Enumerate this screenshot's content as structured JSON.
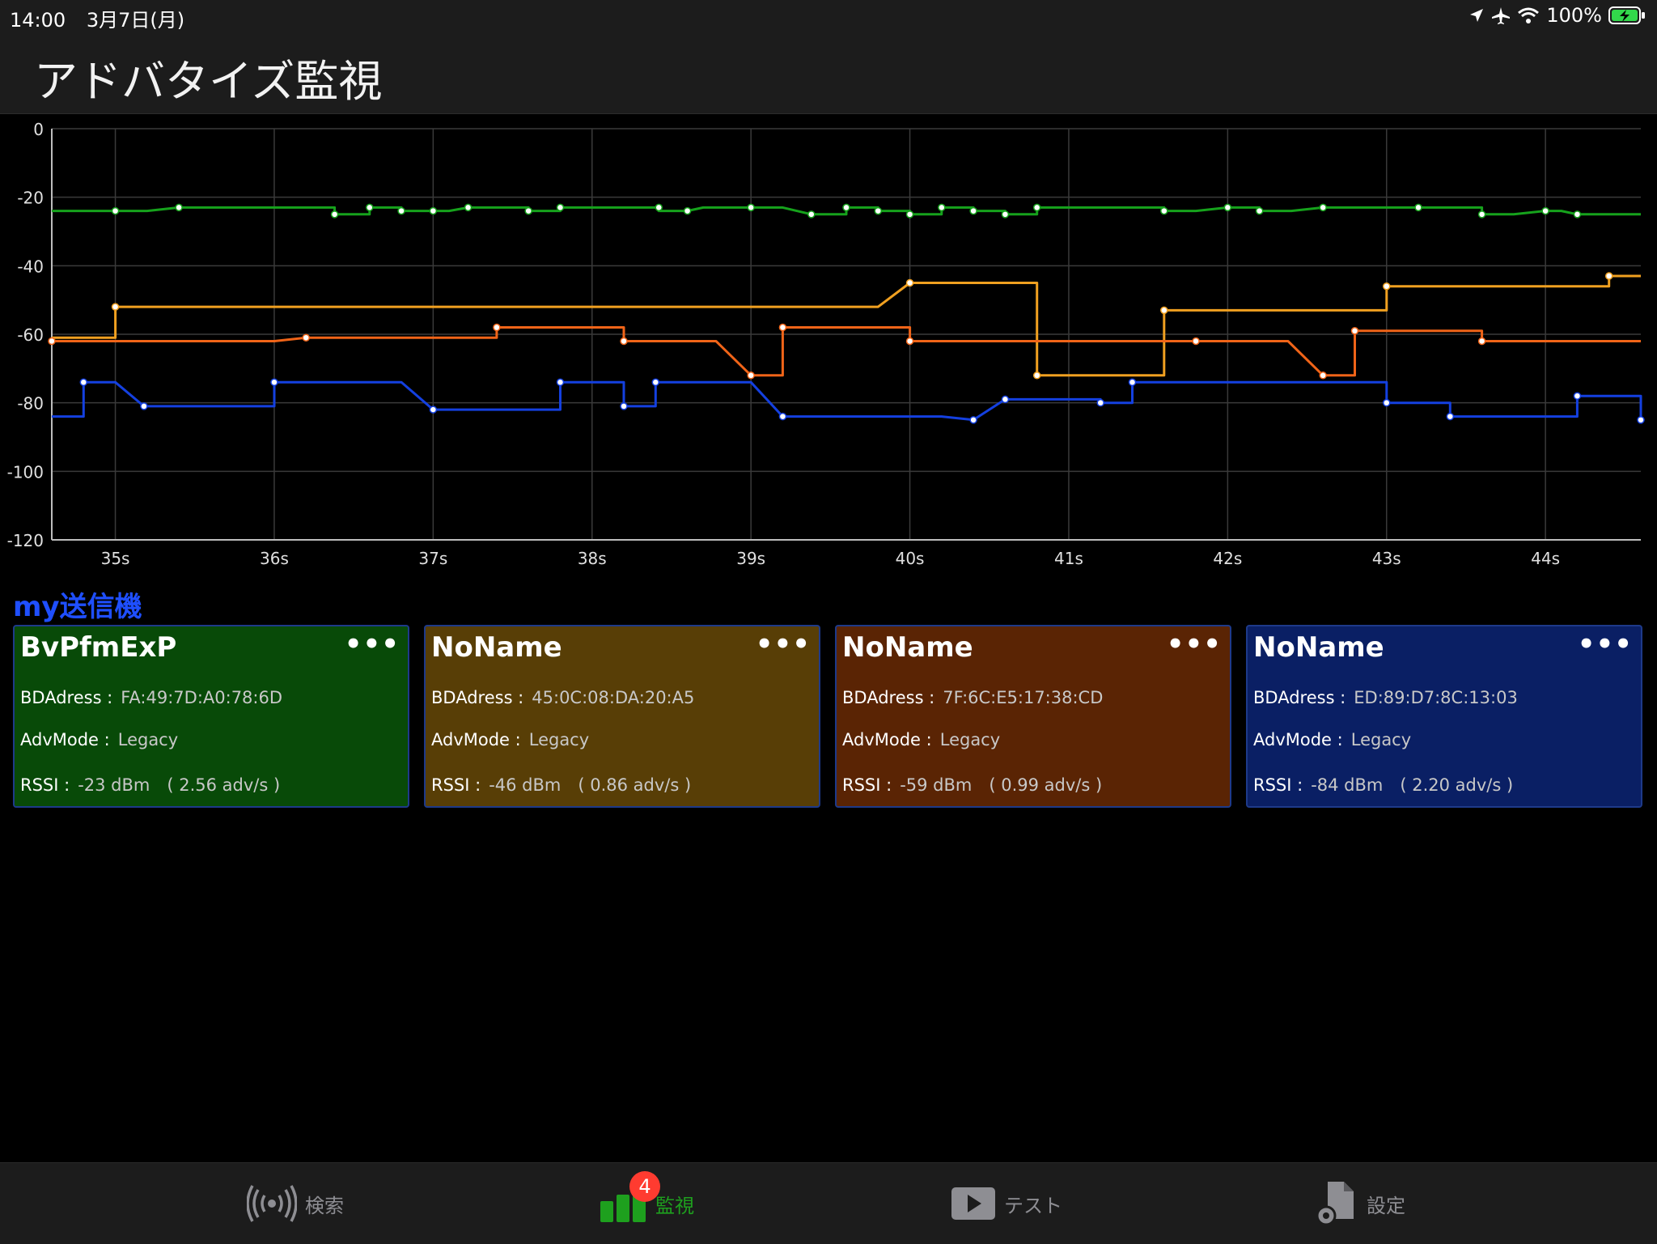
{
  "status": {
    "time": "14:00",
    "date": "3月7日(月)",
    "battery": "100%"
  },
  "nav": {
    "title": "アドバタイズ監視"
  },
  "chart_data": {
    "type": "line",
    "xlim": [
      34.6,
      44.6
    ],
    "ylim": [
      -120,
      0
    ],
    "yticks": [
      "0",
      "-20",
      "-40",
      "-60",
      "-80",
      "-100",
      "-120"
    ],
    "yvals": [
      0,
      -20,
      -40,
      -60,
      -80,
      -100,
      -120
    ],
    "xticks": [
      "35s",
      "36s",
      "37s",
      "38s",
      "39s",
      "40s",
      "41s",
      "42s",
      "43s",
      "44s"
    ],
    "xvals": [
      35,
      36,
      37,
      38,
      39,
      40,
      41,
      42,
      43,
      44
    ],
    "grid": true,
    "series": [
      {
        "color": "#16a21c",
        "points": [
          [
            34.6,
            -24
          ],
          [
            35,
            -24
          ],
          [
            35.2,
            -24
          ],
          [
            35.4,
            -23
          ],
          [
            36,
            -23
          ],
          [
            36.38,
            -23
          ],
          [
            36.38,
            -25
          ],
          [
            36.6,
            -25
          ],
          [
            36.6,
            -23
          ],
          [
            36.8,
            -23
          ],
          [
            36.8,
            -24
          ],
          [
            37,
            -24
          ],
          [
            37.1,
            -24
          ],
          [
            37.22,
            -23
          ],
          [
            37.6,
            -23
          ],
          [
            37.6,
            -24
          ],
          [
            37.8,
            -24
          ],
          [
            37.8,
            -23
          ],
          [
            38.4,
            -23
          ],
          [
            38.42,
            -24
          ],
          [
            38.6,
            -24
          ],
          [
            38.7,
            -23
          ],
          [
            39,
            -23
          ],
          [
            39.2,
            -23
          ],
          [
            39.38,
            -25
          ],
          [
            39.6,
            -25
          ],
          [
            39.6,
            -23
          ],
          [
            39.8,
            -23
          ],
          [
            39.8,
            -24
          ],
          [
            40,
            -24
          ],
          [
            40,
            -25
          ],
          [
            40.2,
            -25
          ],
          [
            40.2,
            -23
          ],
          [
            40.4,
            -23
          ],
          [
            40.4,
            -24
          ],
          [
            40.6,
            -24
          ],
          [
            40.6,
            -25
          ],
          [
            40.8,
            -25
          ],
          [
            40.8,
            -23
          ],
          [
            41.6,
            -23
          ],
          [
            41.6,
            -24
          ],
          [
            41.8,
            -24
          ],
          [
            42,
            -23
          ],
          [
            42.2,
            -23
          ],
          [
            42.2,
            -24
          ],
          [
            42.4,
            -24
          ],
          [
            42.6,
            -23
          ],
          [
            43.2,
            -23
          ],
          [
            43.6,
            -23
          ],
          [
            43.6,
            -25
          ],
          [
            43.8,
            -25
          ],
          [
            44,
            -24
          ],
          [
            44.1,
            -24
          ],
          [
            44.2,
            -25
          ],
          [
            44.6,
            -25
          ]
        ],
        "markers": [
          [
            35,
            -24
          ],
          [
            35.4,
            -23
          ],
          [
            36.38,
            -25
          ],
          [
            36.6,
            -23
          ],
          [
            36.8,
            -24
          ],
          [
            37,
            -24
          ],
          [
            37.22,
            -23
          ],
          [
            37.6,
            -24
          ],
          [
            37.8,
            -23
          ],
          [
            38.42,
            -23
          ],
          [
            38.6,
            -24
          ],
          [
            39,
            -23
          ],
          [
            39.38,
            -25
          ],
          [
            39.6,
            -23
          ],
          [
            39.8,
            -24
          ],
          [
            40,
            -25
          ],
          [
            40.2,
            -23
          ],
          [
            40.4,
            -24
          ],
          [
            40.6,
            -25
          ],
          [
            40.8,
            -23
          ],
          [
            41.6,
            -24
          ],
          [
            42,
            -23
          ],
          [
            42.2,
            -24
          ],
          [
            42.6,
            -23
          ],
          [
            43.2,
            -23
          ],
          [
            43.6,
            -25
          ],
          [
            44,
            -24
          ],
          [
            44.2,
            -25
          ]
        ]
      },
      {
        "color": "#f0a020",
        "points": [
          [
            34.6,
            -61
          ],
          [
            35,
            -61
          ],
          [
            35,
            -52
          ],
          [
            39.8,
            -52
          ],
          [
            40,
            -45
          ],
          [
            40.8,
            -45
          ],
          [
            40.8,
            -72
          ],
          [
            41.6,
            -72
          ],
          [
            41.6,
            -53
          ],
          [
            43,
            -53
          ],
          [
            43,
            -46
          ],
          [
            44.4,
            -46
          ],
          [
            44.4,
            -43
          ],
          [
            44.6,
            -43
          ]
        ],
        "markers": [
          [
            35,
            -52
          ],
          [
            40,
            -45
          ],
          [
            40.8,
            -72
          ],
          [
            41.6,
            -53
          ],
          [
            43,
            -46
          ],
          [
            44.4,
            -43
          ]
        ]
      },
      {
        "color": "#f06418",
        "points": [
          [
            34.6,
            -62
          ],
          [
            36,
            -62
          ],
          [
            36.2,
            -61
          ],
          [
            37.4,
            -61
          ],
          [
            37.4,
            -58
          ],
          [
            38.2,
            -58
          ],
          [
            38.2,
            -62
          ],
          [
            38.78,
            -62
          ],
          [
            39,
            -72
          ],
          [
            39.2,
            -72
          ],
          [
            39.2,
            -58
          ],
          [
            40,
            -58
          ],
          [
            40,
            -62
          ],
          [
            42.38,
            -62
          ],
          [
            42.6,
            -72
          ],
          [
            42.8,
            -72
          ],
          [
            42.8,
            -59
          ],
          [
            43.6,
            -59
          ],
          [
            43.6,
            -62
          ],
          [
            44.6,
            -62
          ]
        ],
        "markers": [
          [
            34.6,
            -62
          ],
          [
            36.2,
            -61
          ],
          [
            37.4,
            -58
          ],
          [
            38.2,
            -62
          ],
          [
            39,
            -72
          ],
          [
            39.2,
            -58
          ],
          [
            40,
            -62
          ],
          [
            41.8,
            -62
          ],
          [
            42.6,
            -72
          ],
          [
            42.8,
            -59
          ],
          [
            43.6,
            -62
          ]
        ]
      },
      {
        "color": "#1440e0",
        "points": [
          [
            34.6,
            -84
          ],
          [
            34.8,
            -84
          ],
          [
            34.8,
            -74
          ],
          [
            35,
            -74
          ],
          [
            35.18,
            -81
          ],
          [
            36,
            -81
          ],
          [
            36,
            -74
          ],
          [
            36.8,
            -74
          ],
          [
            37,
            -82
          ],
          [
            37.8,
            -82
          ],
          [
            37.8,
            -74
          ],
          [
            38.2,
            -74
          ],
          [
            38.2,
            -81
          ],
          [
            38.4,
            -81
          ],
          [
            38.4,
            -74
          ],
          [
            39,
            -74
          ],
          [
            39.2,
            -84
          ],
          [
            40.2,
            -84
          ],
          [
            40.4,
            -85
          ],
          [
            40.6,
            -79
          ],
          [
            41.2,
            -79
          ],
          [
            41.2,
            -80
          ],
          [
            41.4,
            -80
          ],
          [
            41.4,
            -74
          ],
          [
            43,
            -74
          ],
          [
            43,
            -80
          ],
          [
            43.4,
            -80
          ],
          [
            43.4,
            -84
          ],
          [
            44.2,
            -84
          ],
          [
            44.2,
            -78
          ],
          [
            44.6,
            -78
          ],
          [
            44.6,
            -85
          ]
        ],
        "markers": [
          [
            34.8,
            -74
          ],
          [
            35.18,
            -81
          ],
          [
            36,
            -74
          ],
          [
            37,
            -82
          ],
          [
            37.8,
            -74
          ],
          [
            38.2,
            -81
          ],
          [
            38.4,
            -74
          ],
          [
            39.2,
            -84
          ],
          [
            40.4,
            -85
          ],
          [
            40.6,
            -79
          ],
          [
            41.2,
            -80
          ],
          [
            41.4,
            -74
          ],
          [
            43,
            -80
          ],
          [
            43.4,
            -84
          ],
          [
            44.2,
            -78
          ],
          [
            44.6,
            -85
          ]
        ]
      }
    ]
  },
  "section": {
    "title": "my送信機"
  },
  "cards": [
    {
      "name": "BvPfmExP",
      "more": "•••",
      "bd_label": "BDAdress :",
      "bd": "FA:49:7D:A0:78:6D",
      "adv_label": "AdvMode :",
      "adv": "Legacy",
      "rssi_label": "RSSI :",
      "rssi": "-23 dBm　( 2.56 adv/s )",
      "bg": "#084a08"
    },
    {
      "name": "NoName",
      "more": "•••",
      "bd_label": "BDAdress :",
      "bd": "45:0C:08:DA:20:A5",
      "adv_label": "AdvMode :",
      "adv": "Legacy",
      "rssi_label": "RSSI :",
      "rssi": "-46 dBm　( 0.86 adv/s )",
      "bg": "#583e06"
    },
    {
      "name": "NoName",
      "more": "•••",
      "bd_label": "BDAdress :",
      "bd": "7F:6C:E5:17:38:CD",
      "adv_label": "AdvMode :",
      "adv": "Legacy",
      "rssi_label": "RSSI :",
      "rssi": "-59 dBm　( 0.99 adv/s )",
      "bg": "#5a2404"
    },
    {
      "name": "NoName",
      "more": "•••",
      "bd_label": "BDAdress :",
      "bd": "ED:89:D7:8C:13:03",
      "adv_label": "AdvMode :",
      "adv": "Legacy",
      "rssi_label": "RSSI :",
      "rssi": "-84 dBm　( 2.20 adv/s )",
      "bg": "#0a1f64"
    }
  ],
  "tabs": [
    {
      "label": "検索",
      "icon": "broadcast-icon"
    },
    {
      "label": "監視",
      "icon": "bar-chart-icon",
      "badge": "4"
    },
    {
      "label": "テスト",
      "icon": "play-icon"
    },
    {
      "label": "設定",
      "icon": "settings-document-icon"
    }
  ]
}
